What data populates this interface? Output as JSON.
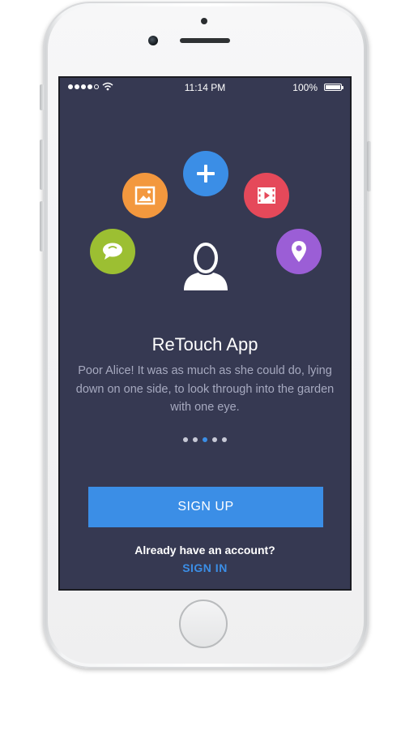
{
  "status_bar": {
    "time": "11:14 PM",
    "battery_percent": "100%",
    "battery_level": 1.0,
    "signal_dots_filled": 4,
    "signal_dots_total": 5
  },
  "feature_icons": [
    {
      "name": "plus-icon",
      "color": "#3b8ee6"
    },
    {
      "name": "image-icon",
      "color": "#f3983e"
    },
    {
      "name": "video-icon",
      "color": "#e5495a"
    },
    {
      "name": "chat-icon",
      "color": "#9cbf32"
    },
    {
      "name": "location-pin-icon",
      "color": "#9b5ed6"
    },
    {
      "name": "user-icon",
      "color": "#ffffff"
    }
  ],
  "onboarding": {
    "title": "ReTouch App",
    "description": "Poor Alice! It was as much as she could do, lying down on one side, to look through into the garden with one eye.",
    "page_count": 5,
    "active_page": 3
  },
  "actions": {
    "signup_label": "SIGN UP",
    "account_question": "Already have an account?",
    "signin_label": "SIGN IN"
  },
  "colors": {
    "background": "#363952",
    "accent": "#3b8ee6",
    "muted_text": "#a6a9bf"
  }
}
